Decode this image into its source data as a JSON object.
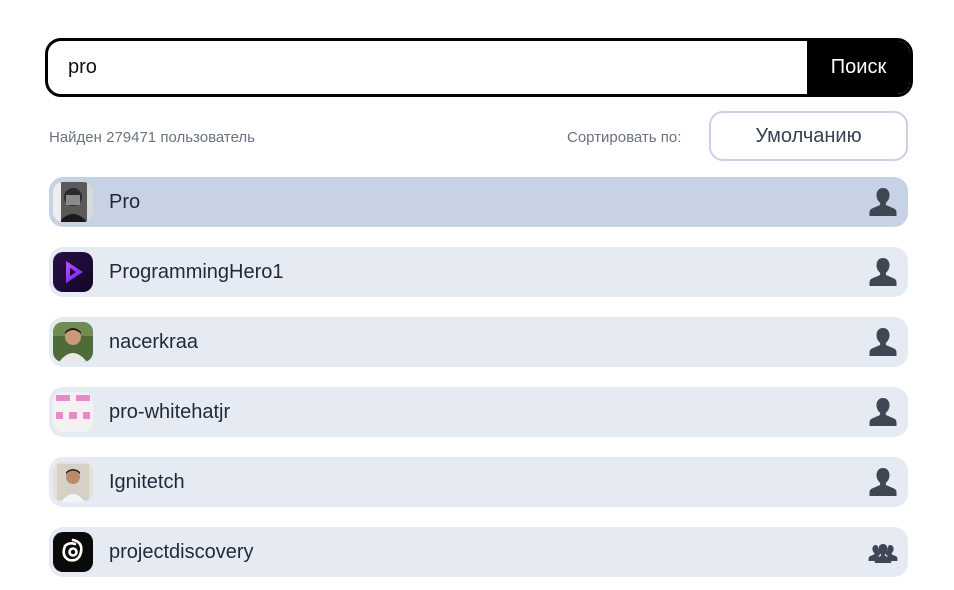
{
  "search": {
    "value": "pro",
    "button_label": "Поиск"
  },
  "results": {
    "count_text": "Найден 279471 пользователь",
    "sort_label": "Сортировать по:",
    "sort_value": "Умолчанию"
  },
  "users": [
    {
      "name": "Pro",
      "avatar": "masked-person-photo",
      "type": "user-icon",
      "selected": true
    },
    {
      "name": "ProgrammingHero1",
      "avatar": "purple-play-logo",
      "type": "user-icon",
      "selected": false
    },
    {
      "name": "nacerkraa",
      "avatar": "person-photo",
      "type": "user-icon",
      "selected": false
    },
    {
      "name": "pro-whitehatjr",
      "avatar": "pink-identicon",
      "type": "user-icon",
      "selected": false
    },
    {
      "name": "Ignitetch",
      "avatar": "person-photo",
      "type": "user-icon",
      "selected": false
    },
    {
      "name": "projectdiscovery",
      "avatar": "spiral-logo",
      "type": "organization-icon",
      "selected": false
    }
  ],
  "colors": {
    "row_background": "#e6eaf3",
    "row_selected": "#c7d2e4",
    "icon": "#3f4654"
  }
}
